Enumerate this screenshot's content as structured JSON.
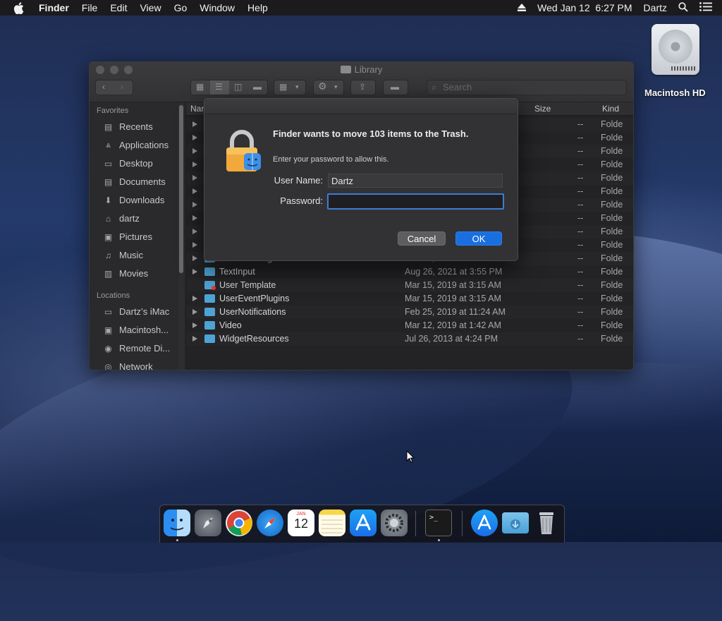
{
  "menubar": {
    "items": [
      "Finder",
      "File",
      "Edit",
      "View",
      "Go",
      "Window",
      "Help"
    ],
    "datetime": "Wed Jan 12  6:27 PM",
    "user": "Dartz"
  },
  "desktop": {
    "drive_label": "Macintosh HD"
  },
  "window": {
    "title": "Library",
    "search_placeholder": "Search",
    "columns": {
      "name": "Nar",
      "size": "Size",
      "kind": "Kind"
    },
    "sidebar": {
      "favorites_header": "Favorites",
      "favorites": [
        {
          "label": "Recents",
          "icon": "recents-icon"
        },
        {
          "label": "Applications",
          "icon": "applications-icon"
        },
        {
          "label": "Desktop",
          "icon": "desktop-icon"
        },
        {
          "label": "Documents",
          "icon": "documents-icon"
        },
        {
          "label": "Downloads",
          "icon": "downloads-icon"
        },
        {
          "label": "dartz",
          "icon": "home-icon"
        },
        {
          "label": "Pictures",
          "icon": "pictures-icon"
        },
        {
          "label": "Music",
          "icon": "music-icon"
        },
        {
          "label": "Movies",
          "icon": "movies-icon"
        }
      ],
      "locations_header": "Locations",
      "locations": [
        {
          "label": "Dartz’s iMac",
          "icon": "imac-icon"
        },
        {
          "label": "Macintosh...",
          "icon": "disk-icon"
        },
        {
          "label": "Remote Di...",
          "icon": "remote-disc-icon"
        },
        {
          "label": "Network",
          "icon": "network-icon"
        }
      ]
    },
    "hidden_rows": [
      {
        "size": "--",
        "kind": "Folde"
      },
      {
        "size": "--",
        "kind": "Folde"
      },
      {
        "size": "--",
        "kind": "Folde"
      },
      {
        "size": "--",
        "kind": "Folde"
      },
      {
        "size": "--",
        "kind": "Folde"
      },
      {
        "size": "--",
        "kind": "Folde"
      },
      {
        "size": "--",
        "kind": "Folde"
      },
      {
        "size": "--",
        "kind": "Folde"
      },
      {
        "size": "--",
        "kind": "Folde"
      },
      {
        "size": "--",
        "kind": "Folde"
      }
    ],
    "rows": [
      {
        "name": "TextEncodings",
        "date": "Feb 25, 2019 at 9:56 AM",
        "size": "--",
        "kind": "Folde"
      },
      {
        "name": "TextInput",
        "date": "Aug 26, 2021 at 3:55 PM",
        "size": "--",
        "kind": "Folde"
      },
      {
        "name": "User Template",
        "date": "Mar 15, 2019 at 3:15 AM",
        "size": "--",
        "kind": "Folde"
      },
      {
        "name": "UserEventPlugins",
        "date": "Mar 15, 2019 at 3:15 AM",
        "size": "--",
        "kind": "Folde"
      },
      {
        "name": "UserNotifications",
        "date": "Feb 25, 2019 at 11:24 AM",
        "size": "--",
        "kind": "Folde"
      },
      {
        "name": "Video",
        "date": "Mar 12, 2019 at 1:42 AM",
        "size": "--",
        "kind": "Folde"
      },
      {
        "name": "WidgetResources",
        "date": "Jul 26, 2013 at 4:24 PM",
        "size": "--",
        "kind": "Folde"
      }
    ]
  },
  "dialog": {
    "message": "Finder wants to move 103 items to the Trash.",
    "subtext": "Enter your password to allow this.",
    "username_label": "User Name:",
    "username_value": "Dartz",
    "password_label": "Password:",
    "password_value": "",
    "cancel_label": "Cancel",
    "ok_label": "OK",
    "accent": "#1a6fe0"
  },
  "dock": {
    "calendar_month": "JAN",
    "calendar_day": "12",
    "apps": [
      "finder-icon",
      "launchpad-icon",
      "chrome-icon",
      "safari-icon",
      "calendar-icon",
      "notes-icon",
      "app-store-icon",
      "system-preferences-icon",
      "terminal-icon",
      "applications-folder-icon",
      "downloads-folder-icon",
      "trash-icon"
    ]
  }
}
